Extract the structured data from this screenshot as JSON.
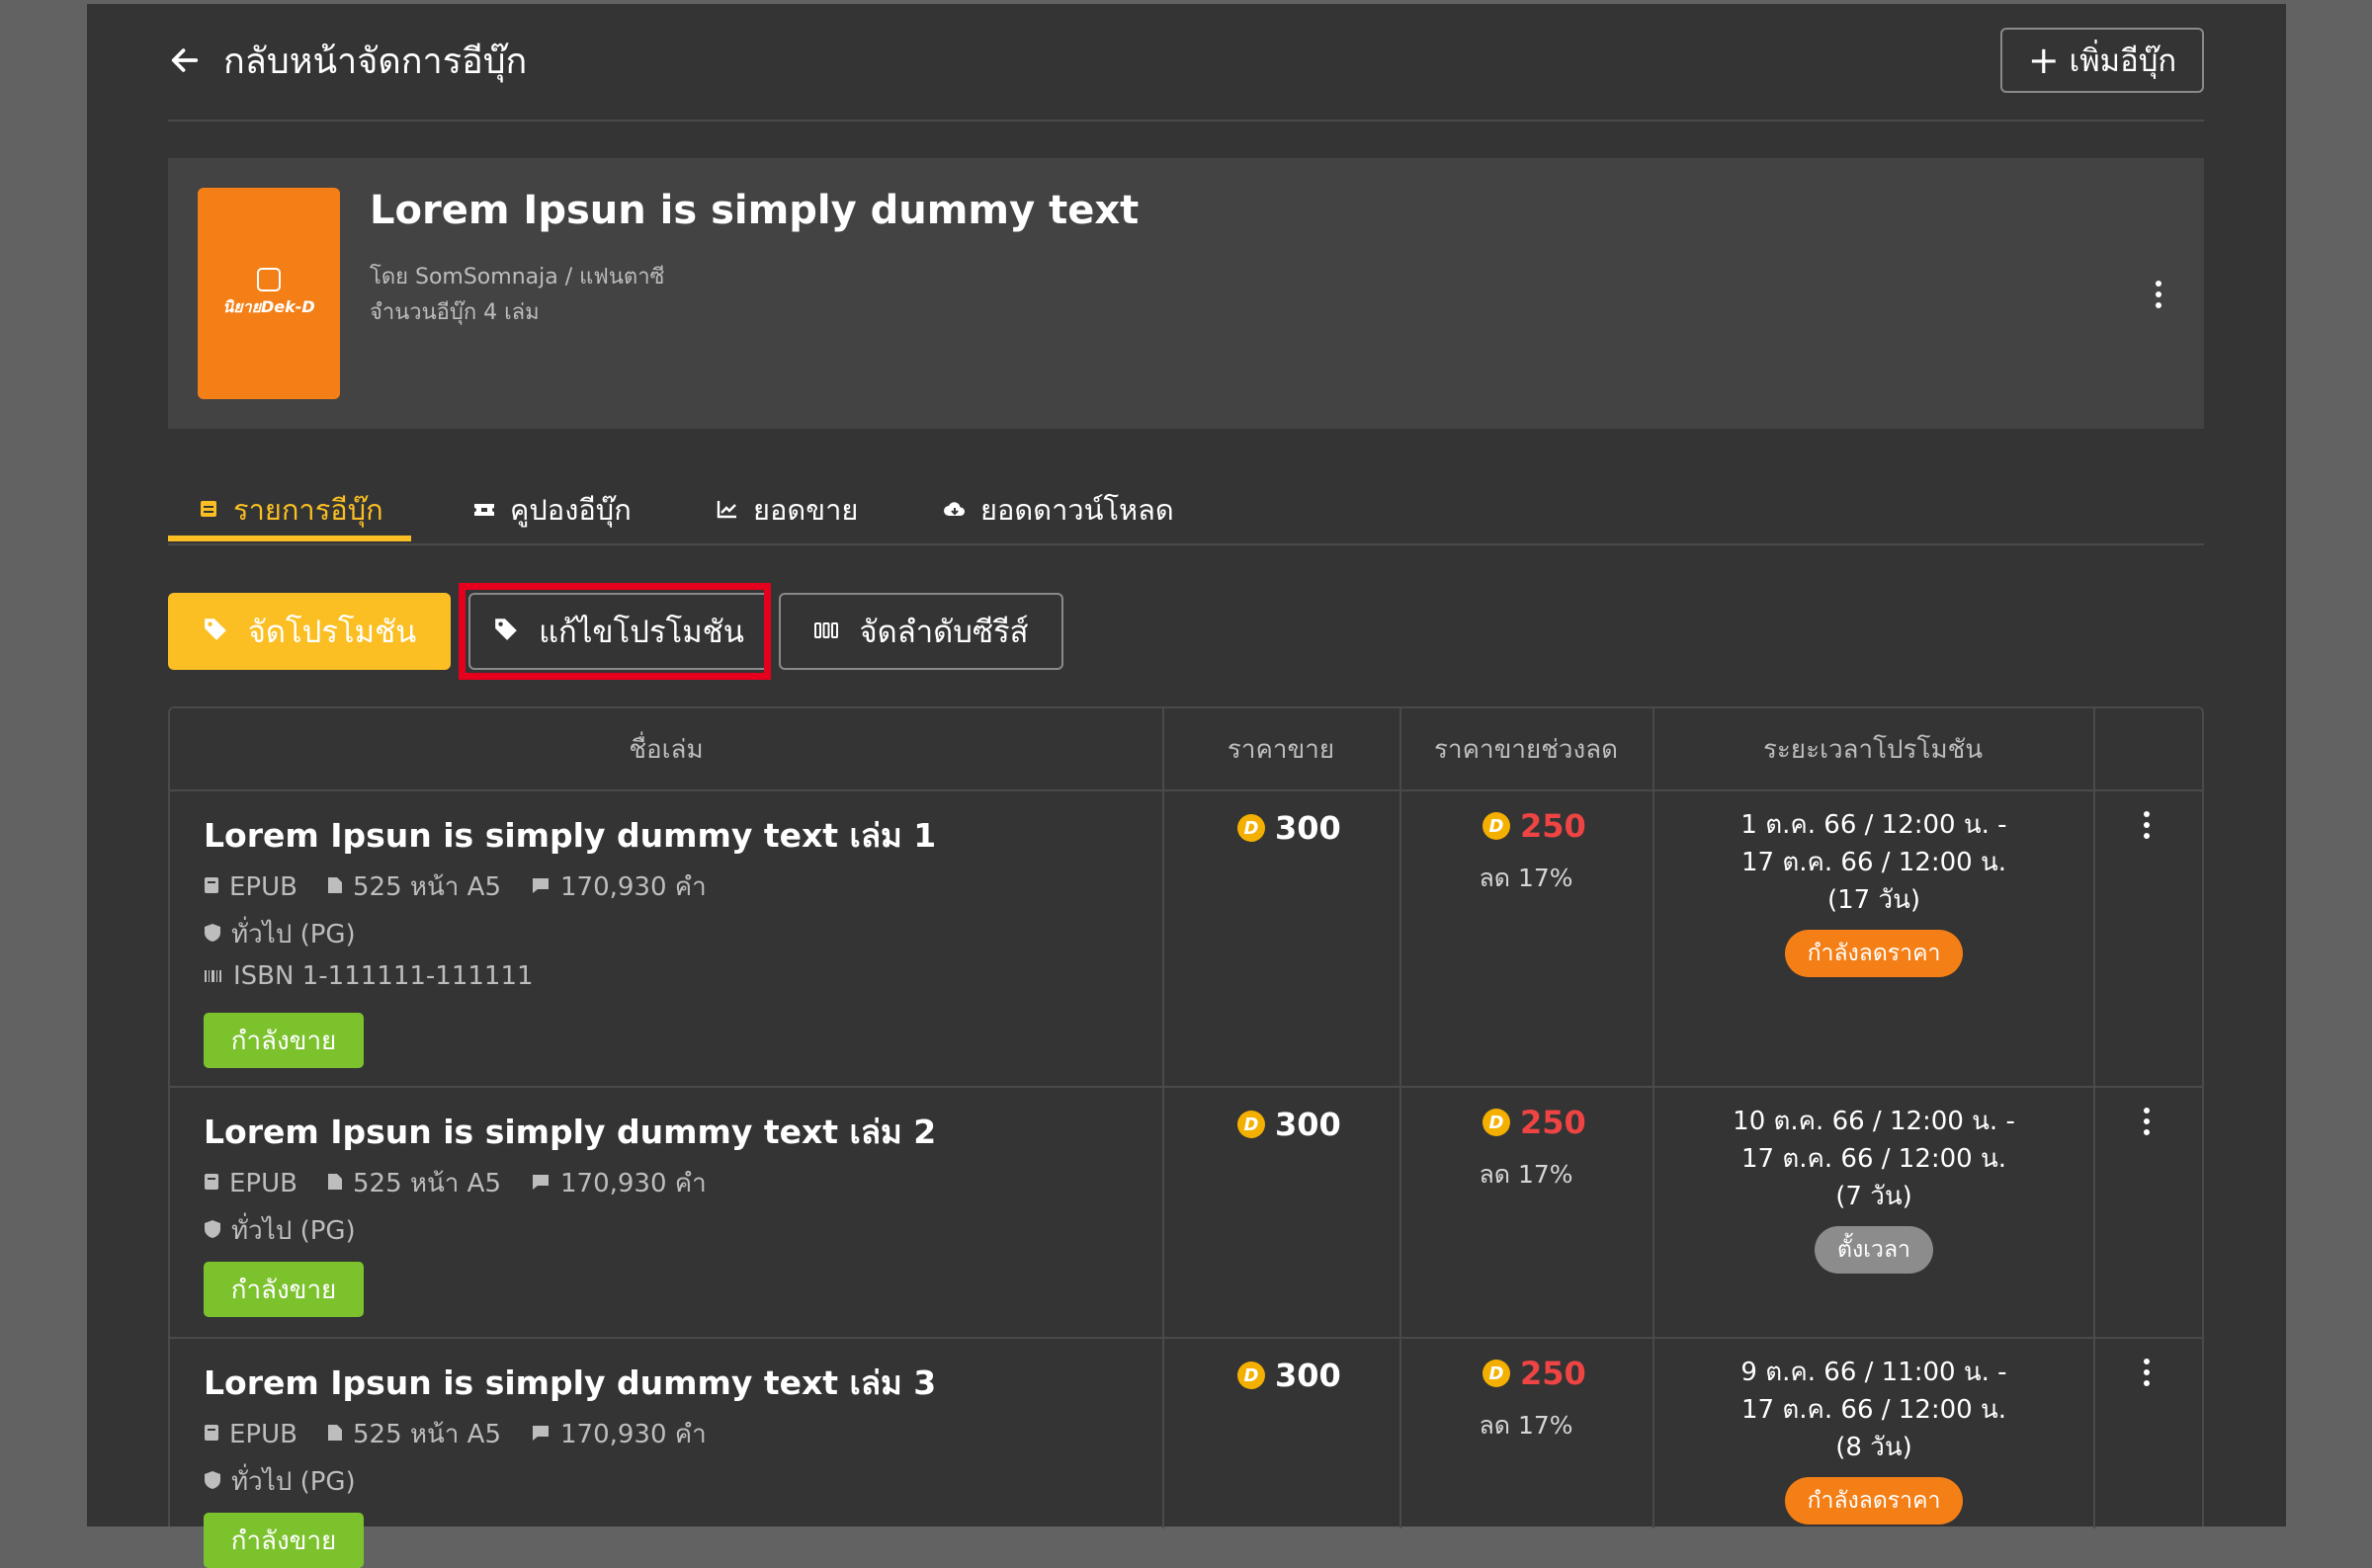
{
  "header": {
    "back_label": "กลับหน้าจัดการอีบุ๊ก",
    "add_label": "เพิ่มอีบุ๊ก"
  },
  "book": {
    "cover_brand": "นิยายDek-D",
    "title": "Lorem Ipsun is simply dummy text",
    "author_line": "โดย SomSomnaja / แฟนตาซี",
    "count_line": "จำนวนอีบุ๊ก 4 เล่ม"
  },
  "tabs": [
    {
      "label": "รายการอีบุ๊ก",
      "icon": "ebook-list-icon"
    },
    {
      "label": "คูปองอีบุ๊ก",
      "icon": "coupon-icon"
    },
    {
      "label": "ยอดขาย",
      "icon": "sales-chart-icon"
    },
    {
      "label": "ยอดดาวน์โหลด",
      "icon": "cloud-download-icon"
    }
  ],
  "actions": {
    "promo_label": "จัดโปรโมชัน",
    "edit_promo_label": "แก้ไขโปรโมชัน",
    "series_order_label": "จัดลำดับซีรีส์"
  },
  "table": {
    "headers": [
      "ชื่อเล่ม",
      "ราคาขาย",
      "ราคาขายช่วงลด",
      "ระยะเวลาโปรโมชัน"
    ],
    "rows": [
      {
        "title": "Lorem Ipsun is simply dummy text เล่ม 1",
        "format": "EPUB",
        "pages": "525 หน้า A5",
        "words": "170,930 คำ",
        "rating": "ทั่วไป (PG)",
        "isbn": "ISBN 1-111111-111111",
        "status": "กำลังขาย",
        "price": "300",
        "sale_price": "250",
        "discount": "ลด 17%",
        "period_start": "1 ต.ค. 66 / 12:00 น. -",
        "period_end": "17 ต.ค. 66 / 12:00 น.",
        "period_days": "(17 วัน)",
        "promo_status": "กำลังลดราคา"
      },
      {
        "title": "Lorem Ipsun is simply dummy text เล่ม 2",
        "format": "EPUB",
        "pages": "525 หน้า A5",
        "words": "170,930 คำ",
        "rating": "ทั่วไป (PG)",
        "status": "กำลังขาย",
        "price": "300",
        "sale_price": "250",
        "discount": "ลด 17%",
        "period_start": "10 ต.ค. 66 / 12:00 น. -",
        "period_end": "17 ต.ค. 66 / 12:00 น.",
        "period_days": "(7 วัน)",
        "promo_status": "ตั้งเวลา"
      },
      {
        "title": "Lorem Ipsun is simply dummy text เล่ม 3",
        "format": "EPUB",
        "pages": "525 หน้า A5",
        "words": "170,930 คำ",
        "rating": "ทั่วไป (PG)",
        "status": "กำลังขาย",
        "price": "300",
        "sale_price": "250",
        "discount": "ลด 17%",
        "period_start": "9 ต.ค. 66 / 11:00 น. -",
        "period_end": "17 ต.ค. 66 / 12:00 น.",
        "period_days": "(8 วัน)",
        "promo_status": "กำลังลดราคา"
      }
    ]
  },
  "colors": {
    "accent": "#fbbf24",
    "sale": "#ef4444",
    "selling": "#7cc22d",
    "discounting": "#f57f17",
    "scheduled": "#8c8c8c",
    "highlight": "#e6001e"
  }
}
